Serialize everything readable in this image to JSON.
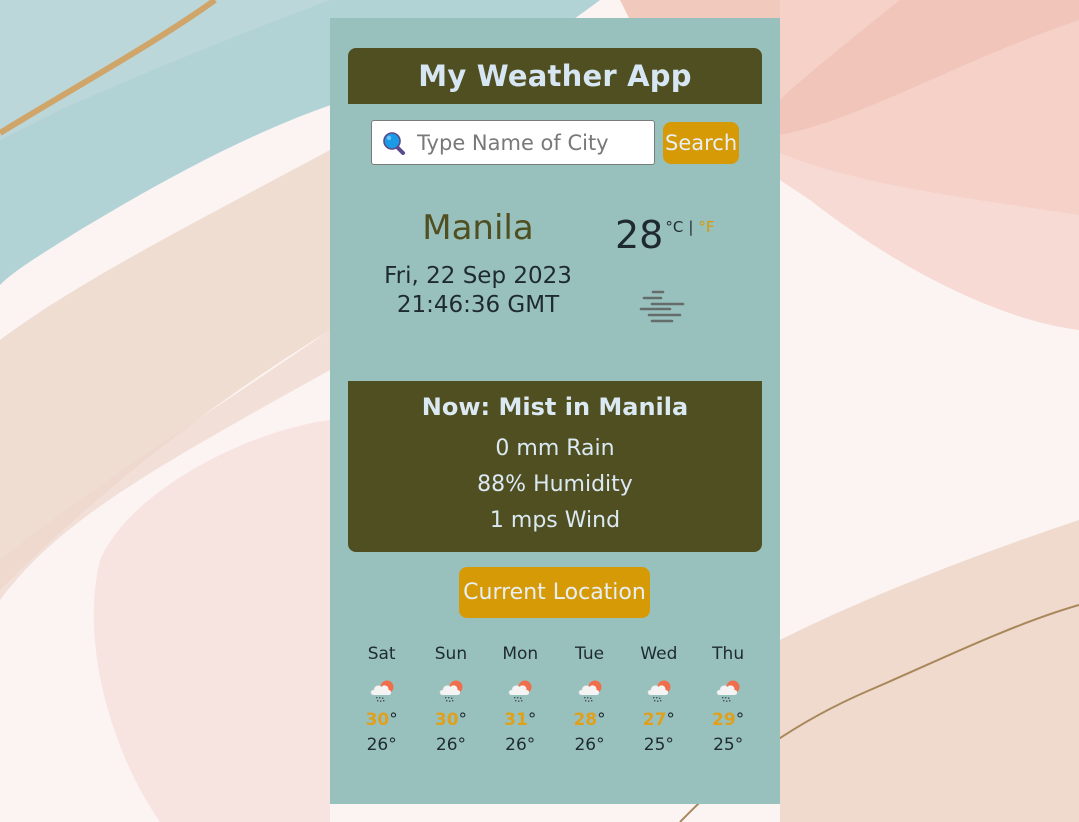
{
  "app": {
    "title": "My Weather App"
  },
  "search": {
    "placeholder": "Type Name of City",
    "value": "",
    "icon": "search-icon",
    "button_label": "Search"
  },
  "current": {
    "city": "Manila",
    "date": "Fri, 22 Sep 2023",
    "time": "21:46:36 GMT",
    "temperature": "28",
    "unit_celsius": "°C",
    "unit_separator": "|",
    "unit_fahrenheit": "°F",
    "icon": "mist-icon"
  },
  "now": {
    "title": "Now: Mist in Manila",
    "rain": "0 mm Rain",
    "humidity": "88% Humidity",
    "wind": "1 mps Wind"
  },
  "location_button": {
    "label": "Current Location"
  },
  "forecast": [
    {
      "day": "Sat",
      "icon": "rain-sun-cloud-icon",
      "high": "30",
      "low": "26°"
    },
    {
      "day": "Sun",
      "icon": "rain-sun-cloud-icon",
      "high": "30",
      "low": "26°"
    },
    {
      "day": "Mon",
      "icon": "rain-sun-cloud-icon",
      "high": "31",
      "low": "26°"
    },
    {
      "day": "Tue",
      "icon": "rain-sun-cloud-icon",
      "high": "28",
      "low": "26°"
    },
    {
      "day": "Wed",
      "icon": "rain-sun-cloud-icon",
      "high": "27",
      "low": "25°"
    },
    {
      "day": "Thu",
      "icon": "rain-sun-cloud-icon",
      "high": "29",
      "low": "25°"
    }
  ],
  "degree_symbol": "°",
  "colors": {
    "panel": "#98c1bd",
    "dark_box": "#504f22",
    "accent": "#d59a05",
    "high_temp": "#e0a01c",
    "title_text": "#d6e6f2"
  }
}
